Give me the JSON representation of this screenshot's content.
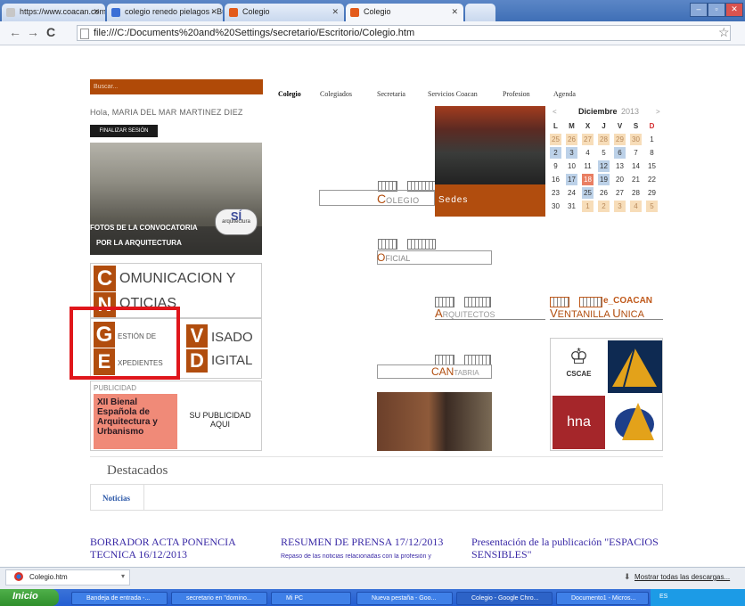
{
  "browser": {
    "tabs": [
      {
        "label": "https://www.coacan.com/g",
        "active": false
      },
      {
        "label": "colegio renedo pielagos - Bu",
        "active": false
      },
      {
        "label": "Colegio",
        "active": false
      },
      {
        "label": "Colegio",
        "active": true
      }
    ],
    "address": "file:///C:/Documents%20and%20Settings/secretario/Escritorio/Colegio.htm"
  },
  "search": {
    "placeholder": "Buscar..."
  },
  "user": {
    "greeting": "Hola, MARIA DEL MAR MARTINEZ DIEZ",
    "logout_label": "FINALIZAR SESIÓN"
  },
  "photo_banner": {
    "caption_1": "FOTOS DE LA CONVOCATORIA",
    "caption_2": "POR LA ARQUITECTURA",
    "badge_big": "SÍ",
    "badge_small": "arquitectura"
  },
  "nav": [
    "Colegio",
    "Colegiados",
    "Secretaria",
    "Servicios Coacan",
    "Profesion",
    "Agenda"
  ],
  "boxes": {
    "cn": {
      "letter1": "C",
      "word1": "OMUNICACION Y",
      "letter2": "N",
      "word2": "OTICIAS"
    },
    "ge": {
      "letter1": "G",
      "word1": "ESTIÓN DE",
      "letter2": "E",
      "word2": "XPEDIENTES"
    },
    "vd": {
      "letter1": "V",
      "word1": "ISADO",
      "letter2": "D",
      "word2": "IGITAL"
    },
    "pub": {
      "label": "PUBLICIDAD",
      "ad_text": "XII Bienal Española de Arquitectura y Urbanismo",
      "cta": "SU PUBLICIDAD AQUI"
    }
  },
  "sections": {
    "colegio": "OLEGIO",
    "colegio_letter": "C",
    "sedes": "Sedes",
    "oficial": "FICIAL",
    "oficial_letter": "O",
    "arquitectos_letter": "A",
    "arquitectos": "RQUITECTOS",
    "ventanilla_title": "e_COACAN",
    "ventanilla": "ENTANILLA",
    "ventanilla_letter": "V",
    "unica": "NICA",
    "unica_letter": "U",
    "cantabria_big": "CAN",
    "cantabria_small": "TABRIA"
  },
  "calendar": {
    "prev": "<",
    "next": ">",
    "month": "Diciembre",
    "year": "2013",
    "weekdays": [
      "L",
      "M",
      "X",
      "J",
      "V",
      "S",
      "D"
    ],
    "rows": [
      [
        "25",
        "26",
        "27",
        "28",
        "29",
        "30",
        "1"
      ],
      [
        "2",
        "3",
        "4",
        "5",
        "6",
        "7",
        "8"
      ],
      [
        "9",
        "10",
        "11",
        "12",
        "13",
        "14",
        "15"
      ],
      [
        "16",
        "17",
        "18",
        "19",
        "20",
        "21",
        "22"
      ],
      [
        "23",
        "24",
        "25",
        "26",
        "27",
        "28",
        "29"
      ],
      [
        "30",
        "31",
        "1",
        "2",
        "3",
        "4",
        "5"
      ]
    ],
    "today": "18"
  },
  "logos": {
    "cscae": "CSCAE",
    "hna": "hna"
  },
  "destacados": {
    "title": "Destacados",
    "tab": "Noticias"
  },
  "news": [
    {
      "title": "BORRADOR ACTA PONENCIA TECNICA 16/12/2013",
      "sub": ""
    },
    {
      "title": "RESUMEN DE PRENSA 17/12/2013",
      "sub": "Repaso de las noticias relacionadas con la profesión y"
    },
    {
      "title": "Presentación de la publicación \"ESPACIOS SENSIBLES\"",
      "sub": ""
    }
  ],
  "downloads": {
    "item": "Colegio.htm",
    "show_all": "Mostrar todas las descargas..."
  },
  "taskbar": {
    "start": "Inicio",
    "tasks": [
      "Bandeja de entrada -...",
      "secretario en \"domino...",
      "Mi PC",
      "Nueva pestaña - Goo...",
      "Colegio - Google Chro...",
      "Documento1 - Micros..."
    ],
    "tray": "ES"
  },
  "colors": {
    "accent": "#b14d0e",
    "link": "#3a2aa6",
    "highlight": "#e0161b"
  }
}
